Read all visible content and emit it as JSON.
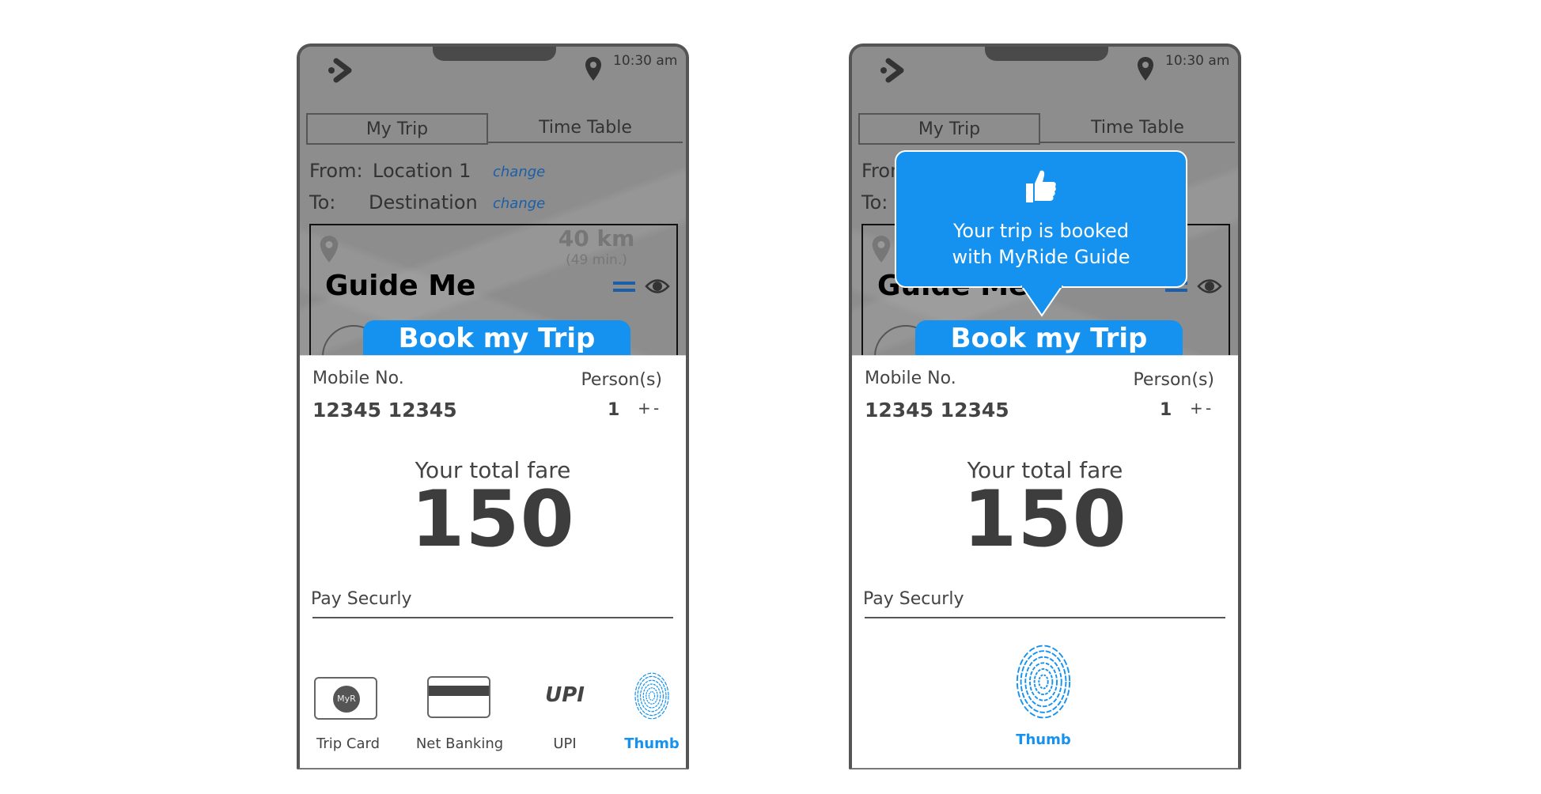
{
  "colors": {
    "accent": "#1592ef",
    "link": "#1b5fa8",
    "frame": "#555555"
  },
  "phones": [
    {
      "status": {
        "time": "10:30 am"
      },
      "tabs": [
        "My Trip",
        "Time Table"
      ],
      "from_label": "From:",
      "from_value": "Location 1",
      "to_label": "To:",
      "to_value": "Destination",
      "change": "change",
      "distance": "40 km",
      "duration": "(49 min.)",
      "guide_title": "Guide Me",
      "book_button": "Book my Trip",
      "mobile_label": "Mobile No.",
      "mobile_value": "12345 12345",
      "persons_label": "Person(s)",
      "persons_value": "1",
      "plus": "+",
      "minus": "-",
      "fare_label": "Your total fare",
      "fare_value": "150",
      "pay_label": "Pay Securly",
      "payment_methods": [
        {
          "label": "Trip Card",
          "icon": "trip-card-icon",
          "logo": "MyR"
        },
        {
          "label": "Net Banking",
          "icon": "card-icon"
        },
        {
          "label": "UPI",
          "icon": "upi-logo",
          "logo": "UPI"
        },
        {
          "label": "Thumb",
          "icon": "fingerprint-icon",
          "selected": true
        }
      ]
    },
    {
      "status": {
        "time": "10:30 am"
      },
      "tabs": [
        "My Trip",
        "Time Table"
      ],
      "from_label": "From:",
      "to_label": "To:",
      "guide_title": "Guide Me",
      "book_button": "Book my Trip",
      "tooltip": {
        "icon": "thumbs-up-icon",
        "line1": "Your trip is booked",
        "line2": "with MyRide Guide"
      },
      "mobile_label": "Mobile No.",
      "mobile_value": "12345 12345",
      "persons_label": "Person(s)",
      "persons_value": "1",
      "plus": "+",
      "minus": "-",
      "fare_label": "Your total fare",
      "fare_value": "150",
      "pay_label": "Pay Securly",
      "thumb_label": "Thumb"
    }
  ]
}
